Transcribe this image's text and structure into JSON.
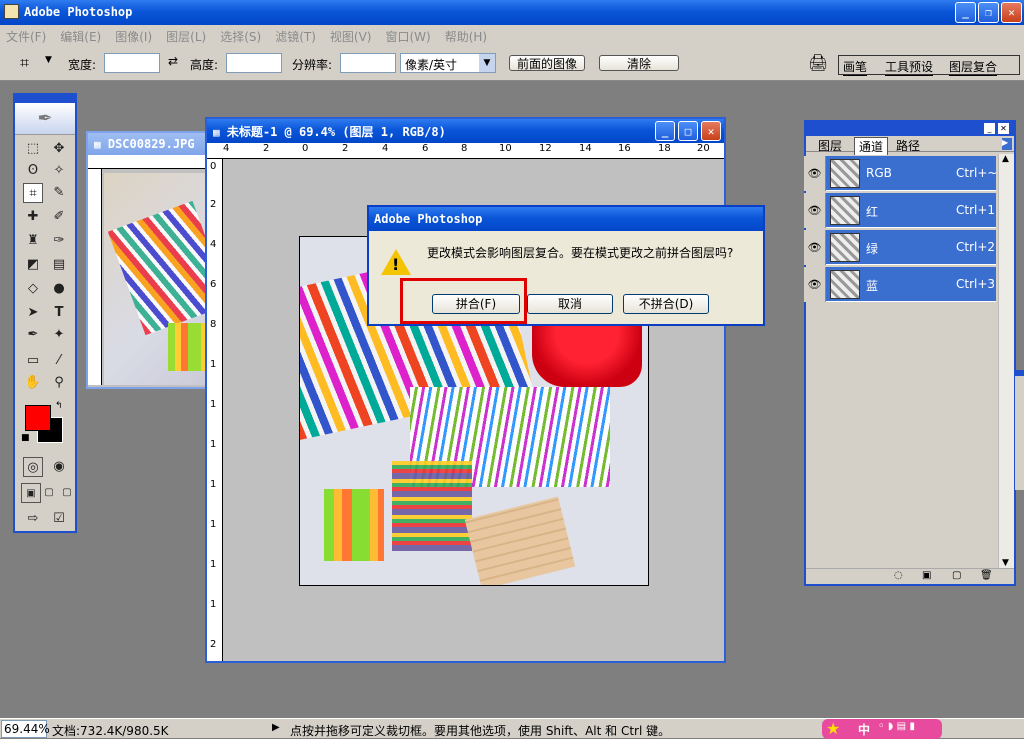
{
  "app": {
    "title": "Adobe Photoshop"
  },
  "menu": [
    "文件(F)",
    "编辑(E)",
    "图像(I)",
    "图层(L)",
    "选择(S)",
    "滤镜(T)",
    "视图(V)",
    "窗口(W)",
    "帮助(H)"
  ],
  "options": {
    "width_label": "宽度:",
    "height_label": "高度:",
    "resolution_label": "分辨率:",
    "unit_select": "像素/英寸",
    "front_image_btn": "前面的图像",
    "clear_btn": "清除"
  },
  "palette_tabs": [
    "画笔",
    "工具预设",
    "图层复合"
  ],
  "doc1": {
    "title": "DSC00829.JPG"
  },
  "doc2": {
    "title": "未标题-1 @ 69.4% (图层 1, RGB/8)"
  },
  "ruler_h": [
    "4",
    "2",
    "0",
    "2",
    "4",
    "6",
    "8",
    "10",
    "12",
    "14",
    "16",
    "18",
    "20"
  ],
  "ruler_v": [
    "0",
    "2",
    "4",
    "6",
    "8",
    "1",
    "1",
    "1",
    "1",
    "1",
    "1",
    "1",
    "2"
  ],
  "dialog": {
    "title": "Adobe Photoshop",
    "message": "更改模式会影响图层复合。要在模式更改之前拼合图层吗?",
    "flatten_btn": "拼合(F)",
    "cancel_btn": "取消",
    "no_flatten_btn": "不拼合(D)",
    "warning_icon": "warning-icon"
  },
  "channels_panel": {
    "tabs": [
      "图层",
      "通道",
      "路径"
    ],
    "rows": [
      {
        "name": "RGB",
        "shortcut": "Ctrl+~"
      },
      {
        "name": "红",
        "shortcut": "Ctrl+1"
      },
      {
        "name": "绿",
        "shortcut": "Ctrl+2"
      },
      {
        "name": "蓝",
        "shortcut": "Ctrl+3"
      }
    ]
  },
  "status": {
    "zoom": "69.44%",
    "doc_size": "文档:732.4K/980.5K",
    "hint": "点按并拖移可定义裁切框。要用其他选项，使用 Shift、Alt 和 Ctrl 键。"
  },
  "ime": {
    "label": "中"
  },
  "colors": {
    "foreground": "#ff0000",
    "background": "#000000",
    "highlight": "#e00000"
  }
}
